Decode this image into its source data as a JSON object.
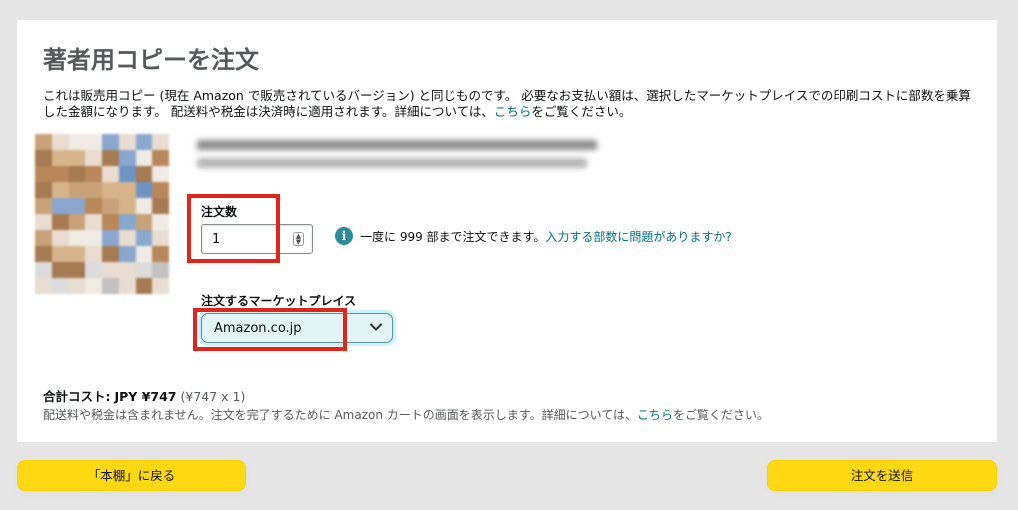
{
  "page": {
    "title": "著者用コピーを注文",
    "description_part1": "これは販売用コピー (現在 Amazon で販売されているバージョン) と同じものです。 必要なお支払い額は、選択したマーケットプレイスでの印刷コストに部数を乗算した金額になります。 配送料や税金は決済時に適用されます。詳細については、",
    "description_link": "こちら",
    "description_part2": "をご覧ください。"
  },
  "quantity": {
    "label": "注文数",
    "value": "1",
    "info_text": "一度に 999 部まで注文できます。",
    "info_link": "入力する部数に問題がありますか?"
  },
  "marketplace": {
    "label": "注文するマーケットプレイス",
    "selected": "Amazon.co.jp"
  },
  "total": {
    "label": "合計コスト:",
    "amount": "JPY ¥747",
    "breakdown": "(¥747 x 1)",
    "note_part1": "配送料や税金は含まれません。注文を完了するために Amazon カートの画面を表示します。詳細については、",
    "note_link": "こちら",
    "note_part2": "をご覧ください。"
  },
  "buttons": {
    "back": "「本棚」に戻る",
    "submit": "注文を送信"
  },
  "colors": {
    "accent_button": "#ffd814",
    "link": "#007185",
    "highlight": "#e1251b"
  }
}
